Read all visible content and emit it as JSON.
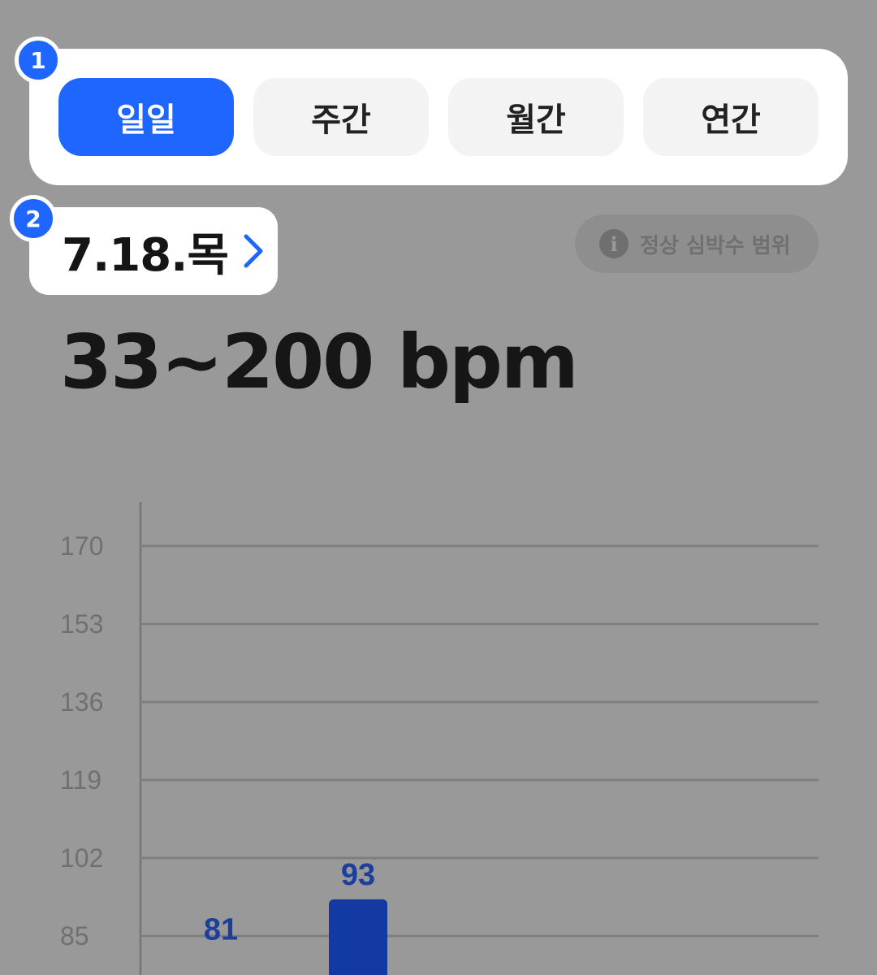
{
  "period_tabs": [
    {
      "label": "일일",
      "active": true
    },
    {
      "label": "주간",
      "active": false
    },
    {
      "label": "월간",
      "active": false
    },
    {
      "label": "연간",
      "active": false
    }
  ],
  "badges": {
    "period": "1",
    "date": "2"
  },
  "date": {
    "label": "7.18.목",
    "next_icon": "chevron-right-icon"
  },
  "normal_range": {
    "label": "정상 심박수 범위",
    "icon": "info-icon",
    "icon_glyph": "i"
  },
  "heart_rate": {
    "range": "33~200 bpm"
  },
  "colors": {
    "accent": "#1f66ff",
    "bar": "#1339a3",
    "value_label": "#1b3f9c"
  },
  "chart_data": {
    "type": "bar",
    "yticks": [
      170,
      153,
      136,
      119,
      102,
      85
    ],
    "series": [
      {
        "values": [
          81,
          93
        ]
      }
    ],
    "value_labels": [
      "81",
      "93"
    ],
    "grid": true
  }
}
